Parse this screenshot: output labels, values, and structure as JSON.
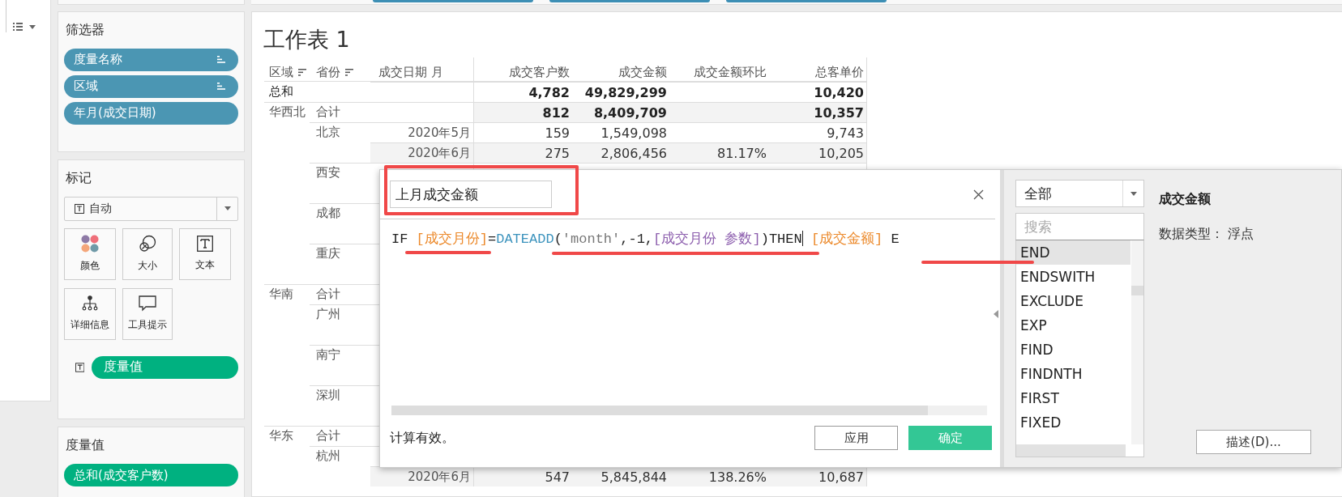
{
  "filters": {
    "title": "筛选器",
    "pills": [
      {
        "label": "度量名称",
        "sorted": true
      },
      {
        "label": "区域",
        "sorted": true
      },
      {
        "label": "年月(成交日期)",
        "sorted": false
      }
    ]
  },
  "marks": {
    "title": "标记",
    "mark_type": "自动",
    "cards": [
      {
        "label": "颜色",
        "kind": "color"
      },
      {
        "label": "大小",
        "kind": "size"
      },
      {
        "label": "文本",
        "kind": "text"
      },
      {
        "label": "详细信息",
        "kind": "detail"
      },
      {
        "label": "工具提示",
        "kind": "tooltip"
      }
    ],
    "text_pill": "度量值"
  },
  "measure_values": {
    "title": "度量值",
    "pills": [
      "总和(成交客户数)"
    ]
  },
  "sheet": {
    "title": "工作表 1",
    "columns": [
      {
        "label": "区域",
        "sorted": true
      },
      {
        "label": "省份",
        "sorted": true
      },
      {
        "label": "成交日期 月",
        "sorted": false
      },
      {
        "label": "成交客户数",
        "sorted": false
      },
      {
        "label": "成交金额",
        "sorted": false
      },
      {
        "label": "成交金额环比",
        "sorted": false
      },
      {
        "label": "总客单价",
        "sorted": false
      }
    ],
    "rows": [
      {
        "kind": "total",
        "region": "总和",
        "customers": "4,782",
        "amount": "49,829,299",
        "unit": "10,420"
      },
      {
        "kind": "subtotal",
        "region": "华西北",
        "province": "合计",
        "customers": "812",
        "amount": "8,409,709",
        "unit": "10,357"
      },
      {
        "kind": "detail",
        "province": "北京",
        "month": "2020年5月",
        "customers": "159",
        "amount": "1,549,098",
        "unit": "9,743",
        "shaded": false
      },
      {
        "kind": "detail",
        "month": "2020年6月",
        "customers": "275",
        "amount": "2,806,456",
        "mom": "81.17%",
        "unit": "10,205",
        "shaded": true
      },
      {
        "kind": "group",
        "province": "西安"
      },
      {
        "kind": "group",
        "province": "成都"
      },
      {
        "kind": "group",
        "province": "重庆"
      },
      {
        "kind": "subtotal",
        "region": "华南",
        "province": "合计"
      },
      {
        "kind": "group",
        "province": "广州"
      },
      {
        "kind": "group",
        "province": "南宁"
      },
      {
        "kind": "group",
        "province": "深圳"
      },
      {
        "kind": "subtotal",
        "region": "华东",
        "province": "合计"
      },
      {
        "kind": "covered",
        "province": "杭州"
      },
      {
        "kind": "detail",
        "month": "2020年6月",
        "customers": "547",
        "amount": "5,845,844",
        "mom": "138.26%",
        "unit": "10,687",
        "shaded": true
      }
    ]
  },
  "dialog": {
    "name": "上月成交金额",
    "formula": [
      {
        "kind": "plain",
        "text": "IF "
      },
      {
        "kind": "field",
        "text": "[成交月份]"
      },
      {
        "kind": "plain",
        "text": "="
      },
      {
        "kind": "function",
        "text": "DATEADD"
      },
      {
        "kind": "plain",
        "text": "("
      },
      {
        "kind": "string",
        "text": "'month'"
      },
      {
        "kind": "plain",
        "text": ",-1,"
      },
      {
        "kind": "param",
        "text": "[成交月份 参数]"
      },
      {
        "kind": "plain",
        "text": ")THEN",
        "cursor_after": true
      },
      {
        "kind": "field",
        "text": " [成交金额]"
      },
      {
        "kind": "plain",
        "text": " E"
      }
    ],
    "status": "计算有效。",
    "buttons": [
      {
        "label": "应用",
        "kind": "secondary"
      },
      {
        "label": "确定",
        "kind": "primary"
      }
    ]
  },
  "functions": {
    "category": "全部",
    "search_placeholder": "搜索",
    "items": [
      {
        "label": "END",
        "selected": true
      },
      {
        "label": "ENDSWITH",
        "selected": false
      },
      {
        "label": "EXCLUDE",
        "selected": false
      },
      {
        "label": "EXP",
        "selected": false
      },
      {
        "label": "FIND",
        "selected": false
      },
      {
        "label": "FINDNTH",
        "selected": false
      },
      {
        "label": "FIRST",
        "selected": false
      },
      {
        "label": "FIXED",
        "selected": false
      }
    ],
    "detail_title": "成交金额",
    "detail_type": "数据类型： 浮点",
    "describe_button": "描述(D)..."
  }
}
